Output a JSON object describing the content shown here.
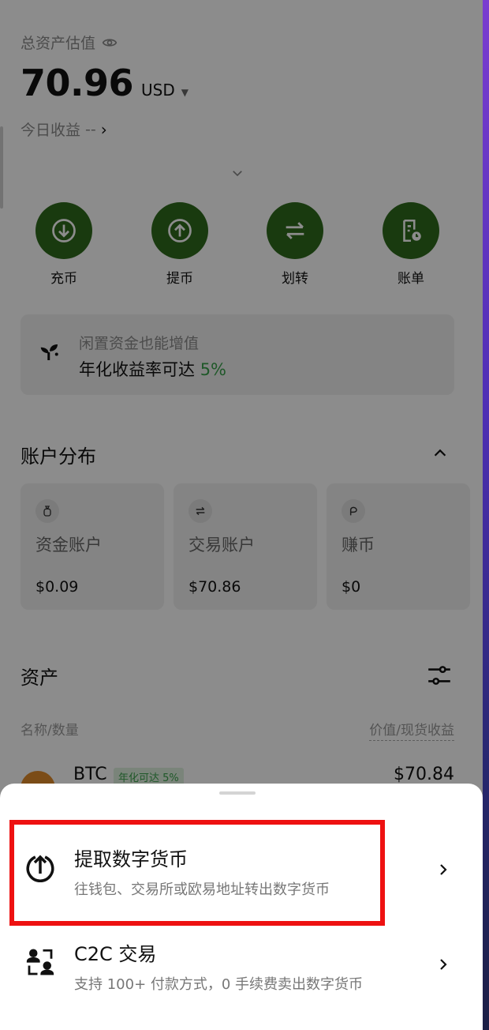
{
  "header": {
    "total_label": "总资产估值",
    "balance": "70.96",
    "currency": "USD",
    "today_label": "今日收益",
    "today_value": "--"
  },
  "actions": [
    {
      "label": "充币",
      "icon": "download-icon"
    },
    {
      "label": "提币",
      "icon": "upload-icon"
    },
    {
      "label": "划转",
      "icon": "transfer-icon"
    },
    {
      "label": "账单",
      "icon": "bill-icon"
    }
  ],
  "promo": {
    "line1": "闲置资金也能增值",
    "line2": "年化收益率可达",
    "rate": "5%"
  },
  "accounts": {
    "title": "账户分布",
    "items": [
      {
        "name": "资金账户",
        "value": "$0.09",
        "icon": "wallet-icon"
      },
      {
        "name": "交易账户",
        "value": "$70.86",
        "icon": "swap-icon"
      },
      {
        "name": "赚币",
        "value": "$0",
        "icon": "earn-icon"
      }
    ]
  },
  "assets": {
    "title": "资产",
    "col_left": "名称/数量",
    "col_right": "价值/现货收益",
    "rows": [
      {
        "name": "BTC",
        "tag": "年化可达 5%",
        "value": "$70.84"
      }
    ]
  },
  "sheet": {
    "options": [
      {
        "title": "提取数字货币",
        "desc": "往钱包、交易所或欧易地址转出数字货币",
        "icon": "withdraw-icon"
      },
      {
        "title": "C2C 交易",
        "desc": "支持 100+ 付款方式，0 手续费卖出数字货币",
        "icon": "c2c-users-icon"
      }
    ]
  },
  "colors": {
    "action_green": "#2f6a1d",
    "accent_green": "#3aa14b",
    "highlight_red": "#ee1111"
  }
}
